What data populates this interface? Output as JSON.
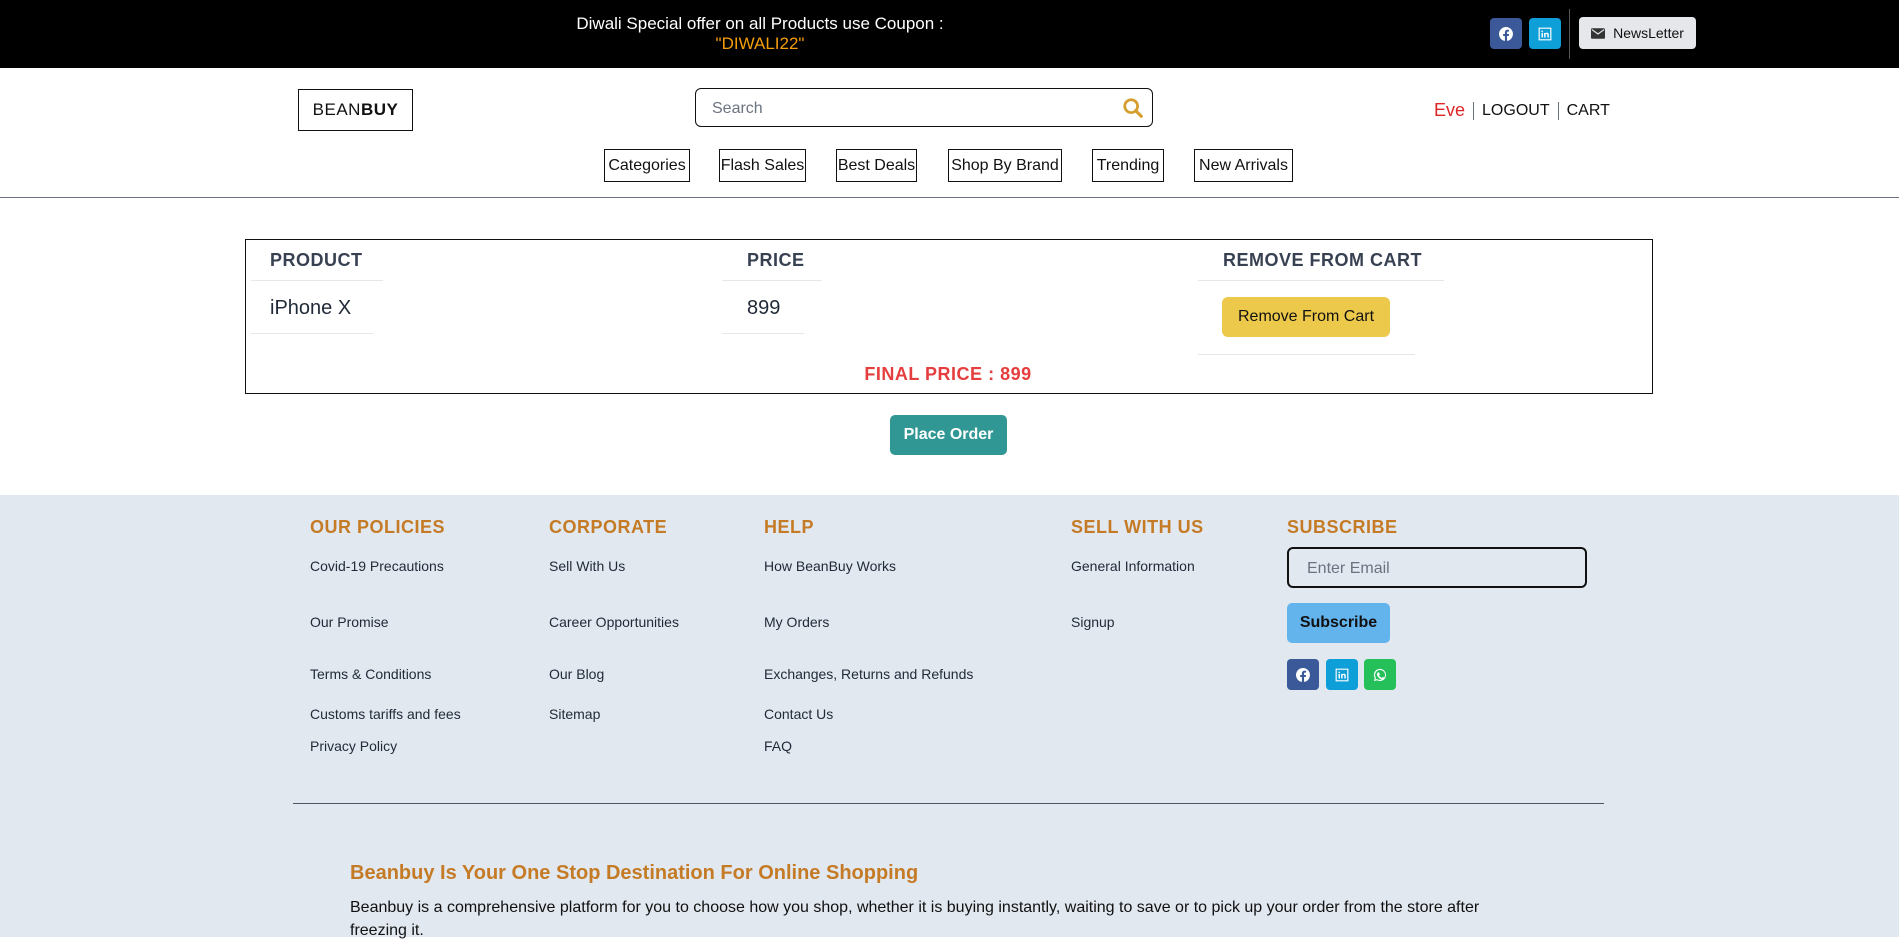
{
  "topbar": {
    "promo_text": "Diwali Special offer on all Products use Coupon :",
    "coupon_code": "\"DIWALI22\"",
    "newsletter_label": "NewsLetter",
    "social_icons": [
      "facebook-icon",
      "linkedin-icon"
    ]
  },
  "header": {
    "logo_light": "BEAN",
    "logo_bold": "BUY",
    "search_placeholder": "Search",
    "user_name": "Eve",
    "logout_label": "LOGOUT",
    "cart_label": "CART"
  },
  "nav": [
    "Categories",
    "Flash Sales",
    "Best Deals",
    "Shop By Brand",
    "Trending",
    "New Arrivals"
  ],
  "cart": {
    "headers": [
      "PRODUCT",
      "PRICE",
      "REMOVE FROM CART"
    ],
    "rows": [
      {
        "product": "iPhone X",
        "price": "899",
        "action_label": "Remove From Cart"
      }
    ],
    "final_price_text": "FINAL PRICE : 899",
    "place_order_label": "Place Order"
  },
  "footer": {
    "columns": [
      {
        "title": "OUR POLICIES",
        "links": [
          "Covid-19 Precautions",
          "Our Promise",
          "Terms & Conditions",
          "Customs tariffs and fees",
          "Privacy Policy"
        ]
      },
      {
        "title": "CORPORATE",
        "links": [
          "Sell With Us",
          "Career Opportunities",
          "Our Blog",
          "Sitemap"
        ]
      },
      {
        "title": "HELP",
        "links": [
          "How BeanBuy Works",
          "My Orders",
          "Exchanges, Returns and Refunds",
          "Contact Us",
          "FAQ"
        ]
      },
      {
        "title": "SELL WITH US",
        "links": [
          "General Information",
          "Signup"
        ]
      }
    ],
    "subscribe": {
      "title": "SUBSCRIBE",
      "email_placeholder": "Enter Email",
      "button_label": "Subscribe",
      "social_icons": [
        "facebook-icon",
        "linkedin-icon",
        "whatsapp-icon"
      ]
    },
    "tagline": "Beanbuy Is Your One Stop Destination For Online Shopping",
    "description": "Beanbuy is a comprehensive platform for you to choose how you shop, whether it is buying instantly, waiting to save or to pick up your order from the store after freezing it."
  }
}
